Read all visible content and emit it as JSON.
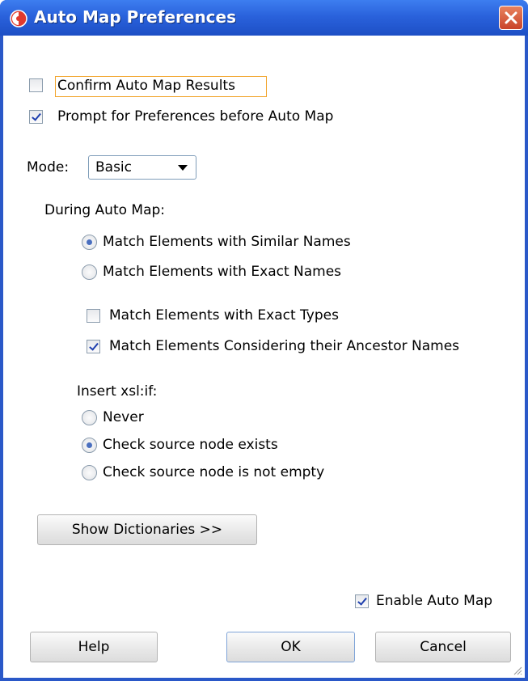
{
  "window": {
    "title": "Auto Map Preferences",
    "icon": "oracle-logo-icon",
    "close_icon": "close-icon"
  },
  "options": {
    "confirm_auto_map": {
      "label": "Confirm Auto Map Results",
      "checked": false
    },
    "prompt_preferences": {
      "label": "Prompt for Preferences before Auto Map",
      "checked": true
    }
  },
  "mode": {
    "label": "Mode:",
    "value": "Basic"
  },
  "during": {
    "heading": "During Auto Map:",
    "similar_names": {
      "label": "Match Elements with Similar Names",
      "selected": true
    },
    "exact_names": {
      "label": "Match Elements with Exact Names",
      "selected": false
    },
    "exact_types": {
      "label": "Match Elements with Exact Types",
      "checked": false
    },
    "ancestor_names": {
      "label": "Match Elements Considering their Ancestor Names",
      "checked": true
    }
  },
  "insert_if": {
    "heading": "Insert xsl:if:",
    "never": {
      "label": "Never",
      "selected": false
    },
    "exists": {
      "label": "Check source node exists",
      "selected": true
    },
    "not_empty": {
      "label": "Check source node is not empty",
      "selected": false
    }
  },
  "buttons": {
    "show_dictionaries": "Show Dictionaries >>",
    "help": "Help",
    "ok": "OK",
    "cancel": "Cancel"
  },
  "enable_auto_map": {
    "label": "Enable Auto Map",
    "checked": true
  },
  "colors": {
    "title_bar": "#2a62dc",
    "focus": "#f2a42b",
    "close": "#c9432a"
  }
}
